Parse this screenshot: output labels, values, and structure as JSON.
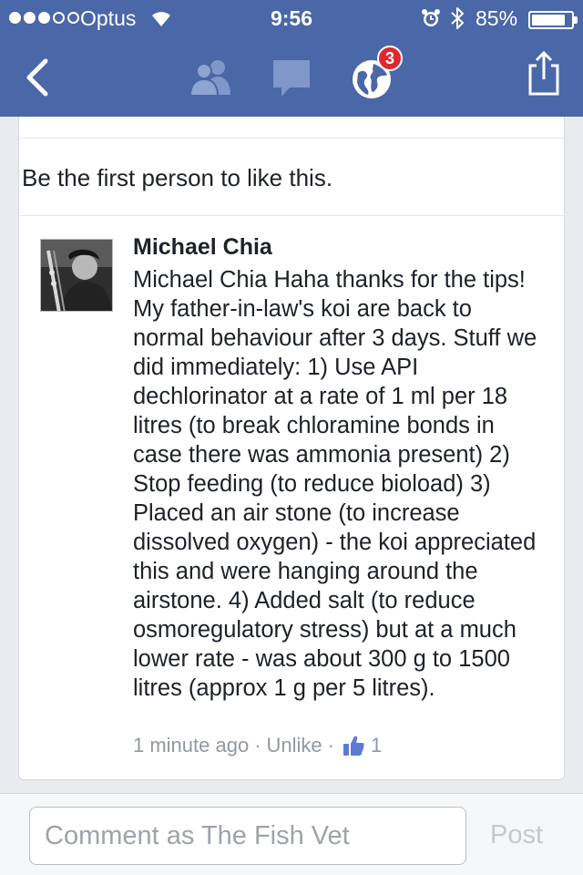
{
  "status_bar": {
    "carrier": "Optus",
    "time": "9:56",
    "battery_percent": "85%",
    "battery_level": 0.85,
    "signal_bars": 3,
    "signal_total": 5
  },
  "nav": {
    "notification_count": "3",
    "icons": [
      "back-icon",
      "friends-icon",
      "messages-icon",
      "globe-icon",
      "share-icon"
    ]
  },
  "likes": {
    "text": "Be the first person to like this."
  },
  "comment": {
    "author": "Michael Chia",
    "text": "Michael Chia Haha thanks for the tips! My father-in-law's koi are back to normal behaviour after 3 days. Stuff we did immediately: 1) Use API dechlorinator at a rate of 1 ml per 18 litres (to break chloramine bonds in case there was ammonia present) 2) Stop feeding (to reduce bioload) 3) Placed an air stone (to increase dissolved oxygen) - the koi appreciated this and were hanging around the airstone. 4) Added salt (to reduce osmoregulatory stress) but at a much lower rate - was about 300 g to 1500 litres (approx 1 g per 5 litres).",
    "timestamp": "1 minute ago",
    "separator": "·",
    "unlike_label": "Unlike",
    "like_count": "1"
  },
  "composer": {
    "placeholder": "Comment as The Fish Vet",
    "value": "",
    "post_label": "Post"
  },
  "colors": {
    "nav_blue": "#4a67a8",
    "badge_red": "#e0262e",
    "like_blue": "#5b7bd5",
    "muted_text": "#9197a3"
  }
}
